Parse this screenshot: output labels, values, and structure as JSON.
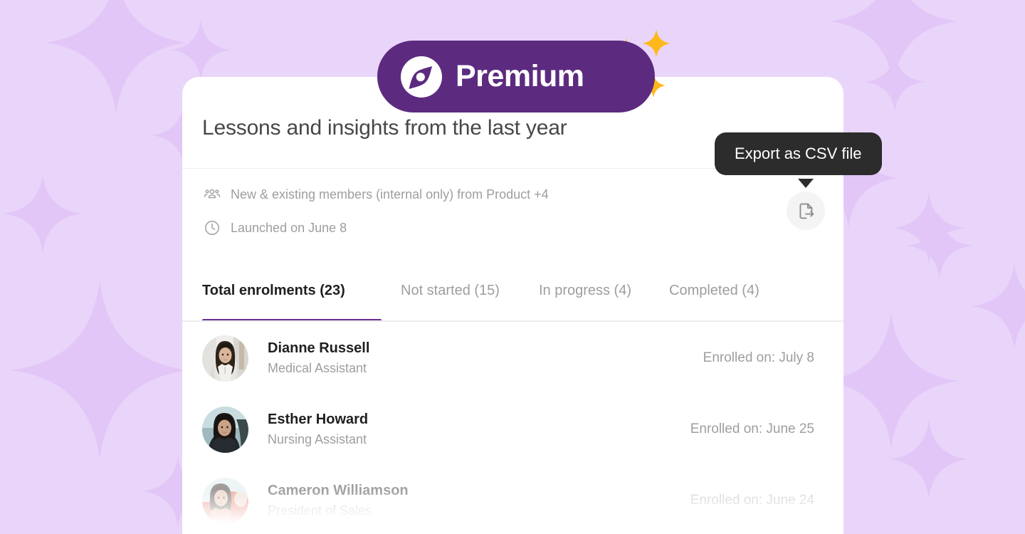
{
  "theme": {
    "page_background": "#e9d5fa",
    "sparkle_background": "#e0c4f5",
    "brand_purple": "#5c2b80",
    "accent_underline": "#6b2d8e",
    "badge_sparkle_gold": "#ffb81c",
    "card_background": "#ffffff",
    "tooltip_background": "#2c2c2c",
    "muted_text": "#9e9e9e",
    "primary_text": "#1f1f1f"
  },
  "badge": {
    "label": "Premium",
    "icon": "compass-icon",
    "sparkles_icon": "sparkles-icon"
  },
  "card": {
    "title": "Lessons and insights from the last year",
    "meta": [
      {
        "icon": "people-group-icon",
        "text": "New & existing members (internal only) from Product +4"
      },
      {
        "icon": "clock-icon",
        "text": "Launched on June 8"
      }
    ],
    "export_button": {
      "icon": "export-file-icon",
      "tooltip": "Export as CSV file"
    },
    "tabs": [
      {
        "label": "Total enrolments (23)",
        "active": true
      },
      {
        "label": "Not started (15)",
        "active": false
      },
      {
        "label": "In progress (4)",
        "active": false
      },
      {
        "label": "Completed (4)",
        "active": false
      }
    ],
    "enrollees": [
      {
        "name": "Dianne Russell",
        "role": "Medical Assistant",
        "enrolled": "Enrolled on: July 8",
        "avatar": "avatar-dianne-russell",
        "faded": false
      },
      {
        "name": "Esther Howard",
        "role": "Nursing Assistant",
        "enrolled": "Enrolled on: June 25",
        "avatar": "avatar-esther-howard",
        "faded": false
      },
      {
        "name": "Cameron Williamson",
        "role": "President of Sales",
        "enrolled": "Enrolled on: June 24",
        "avatar": "avatar-cameron-williamson",
        "faded": true
      }
    ]
  }
}
